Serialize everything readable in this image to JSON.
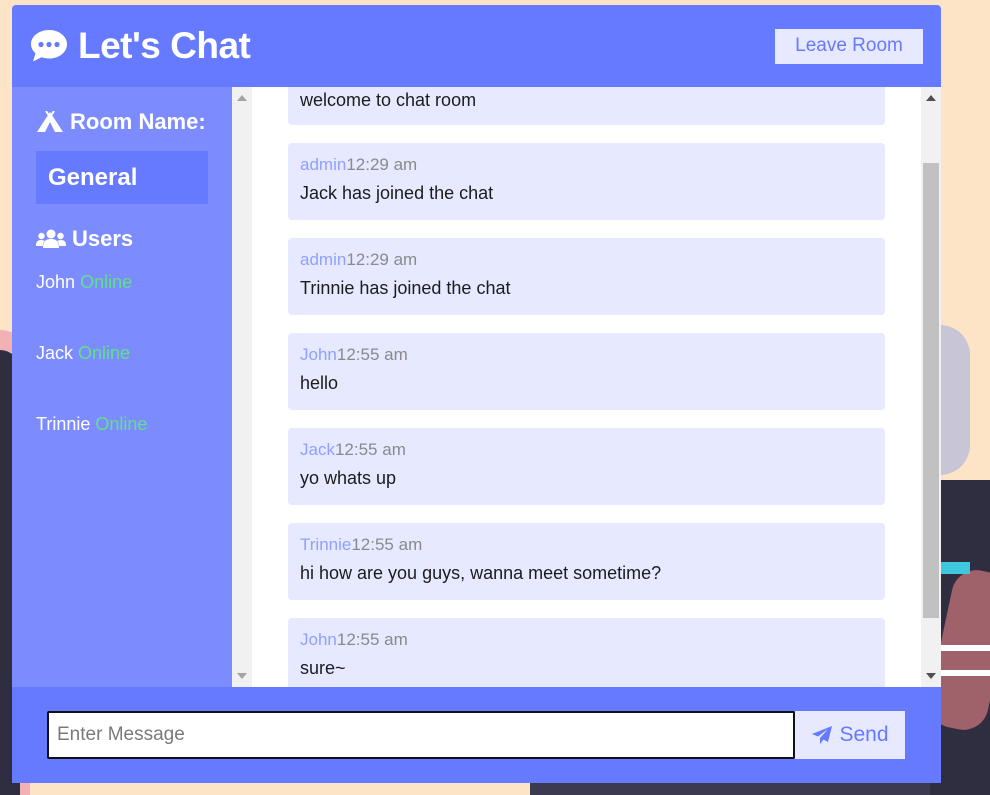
{
  "header": {
    "title": "Let's Chat",
    "leave_label": "Leave Room"
  },
  "sidebar": {
    "room_heading": "Room Name:",
    "room_name": "General",
    "users_heading": "Users",
    "users": [
      {
        "name": "John",
        "status": "Online"
      },
      {
        "name": "Jack",
        "status": "Online"
      },
      {
        "name": "Trinnie",
        "status": "Online"
      }
    ]
  },
  "messages": [
    {
      "author": "",
      "time": "",
      "text": "welcome to chat room"
    },
    {
      "author": "admin",
      "time": "12:29 am",
      "text": "Jack has joined the chat"
    },
    {
      "author": "admin",
      "time": "12:29 am",
      "text": "Trinnie has joined the chat"
    },
    {
      "author": "John",
      "time": "12:55 am",
      "text": "hello"
    },
    {
      "author": "Jack",
      "time": "12:55 am",
      "text": "yo whats up"
    },
    {
      "author": "Trinnie",
      "time": "12:55 am",
      "text": "hi how are you guys, wanna meet sometime?"
    },
    {
      "author": "John",
      "time": "12:55 am",
      "text": "sure~"
    }
  ],
  "composer": {
    "placeholder": "Enter Message",
    "send_label": "Send"
  },
  "icons": {
    "brand": "comment-dots-icon",
    "room": "campground-icon",
    "users": "users-icon",
    "send": "paper-plane-icon"
  },
  "colors": {
    "primary": "#667aff",
    "sidebar": "#7c8cff",
    "light": "#e6e9ff",
    "online": "#5fe08a",
    "background": "#fde4c6"
  }
}
